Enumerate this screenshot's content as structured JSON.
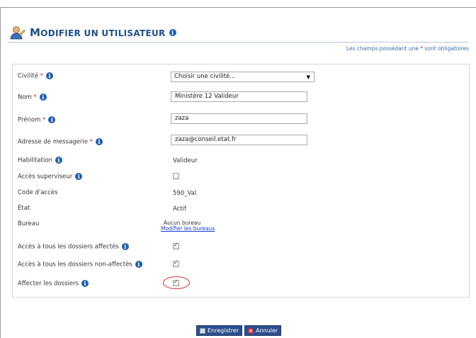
{
  "page": {
    "title_cap": "M",
    "title_rest": "ODIFIER UN UTILISATEUR",
    "required_note_before": "Les champs possédant une ",
    "required_star": "*",
    "required_note_after": " sont obligatoires"
  },
  "form": {
    "civilite": {
      "label": "Civilité",
      "star": "*",
      "value": "Choisir une civilité..."
    },
    "nom": {
      "label": "Nom",
      "star": "*",
      "value": "Ministère 12 Valideur"
    },
    "prenom": {
      "label": "Prénom",
      "star": "*",
      "value": "zaza"
    },
    "email": {
      "label": "Adresse de messagerie",
      "star": "*",
      "value": "zaza@conseil.etat.fr"
    },
    "habilitation": {
      "label": "Habilitation",
      "value": "Valideur"
    },
    "acces_superviseur": {
      "label": "Accès superviseur",
      "checked": false
    },
    "code_acces": {
      "label": "Code d'accès",
      "value": "590_Val"
    },
    "etat": {
      "label": "État",
      "value": "Actif"
    },
    "bureau": {
      "label": "Bureau",
      "value": "Aucun bureau",
      "link": "Modifier les bureaux"
    },
    "acces_affectes": {
      "label": "Accès à tous les dossiers affectés",
      "checked": true
    },
    "acces_non_affectes": {
      "label": "Accès à tous les dossiers non-affectés",
      "checked": true
    },
    "affecter_dossiers": {
      "label": "Affecter les dossiers",
      "checked": true
    }
  },
  "buttons": {
    "save": "Enregistrer",
    "cancel": "Annuler"
  },
  "icons": {
    "info": "i",
    "header": "user-edit-icon",
    "save": "floppy-icon",
    "cancel": "cancel-icon",
    "caret": "▼"
  },
  "colors": {
    "title": "#1f4e8c",
    "required": "#e02020",
    "button": "#2c4f8c",
    "highlight": "#e03030"
  }
}
